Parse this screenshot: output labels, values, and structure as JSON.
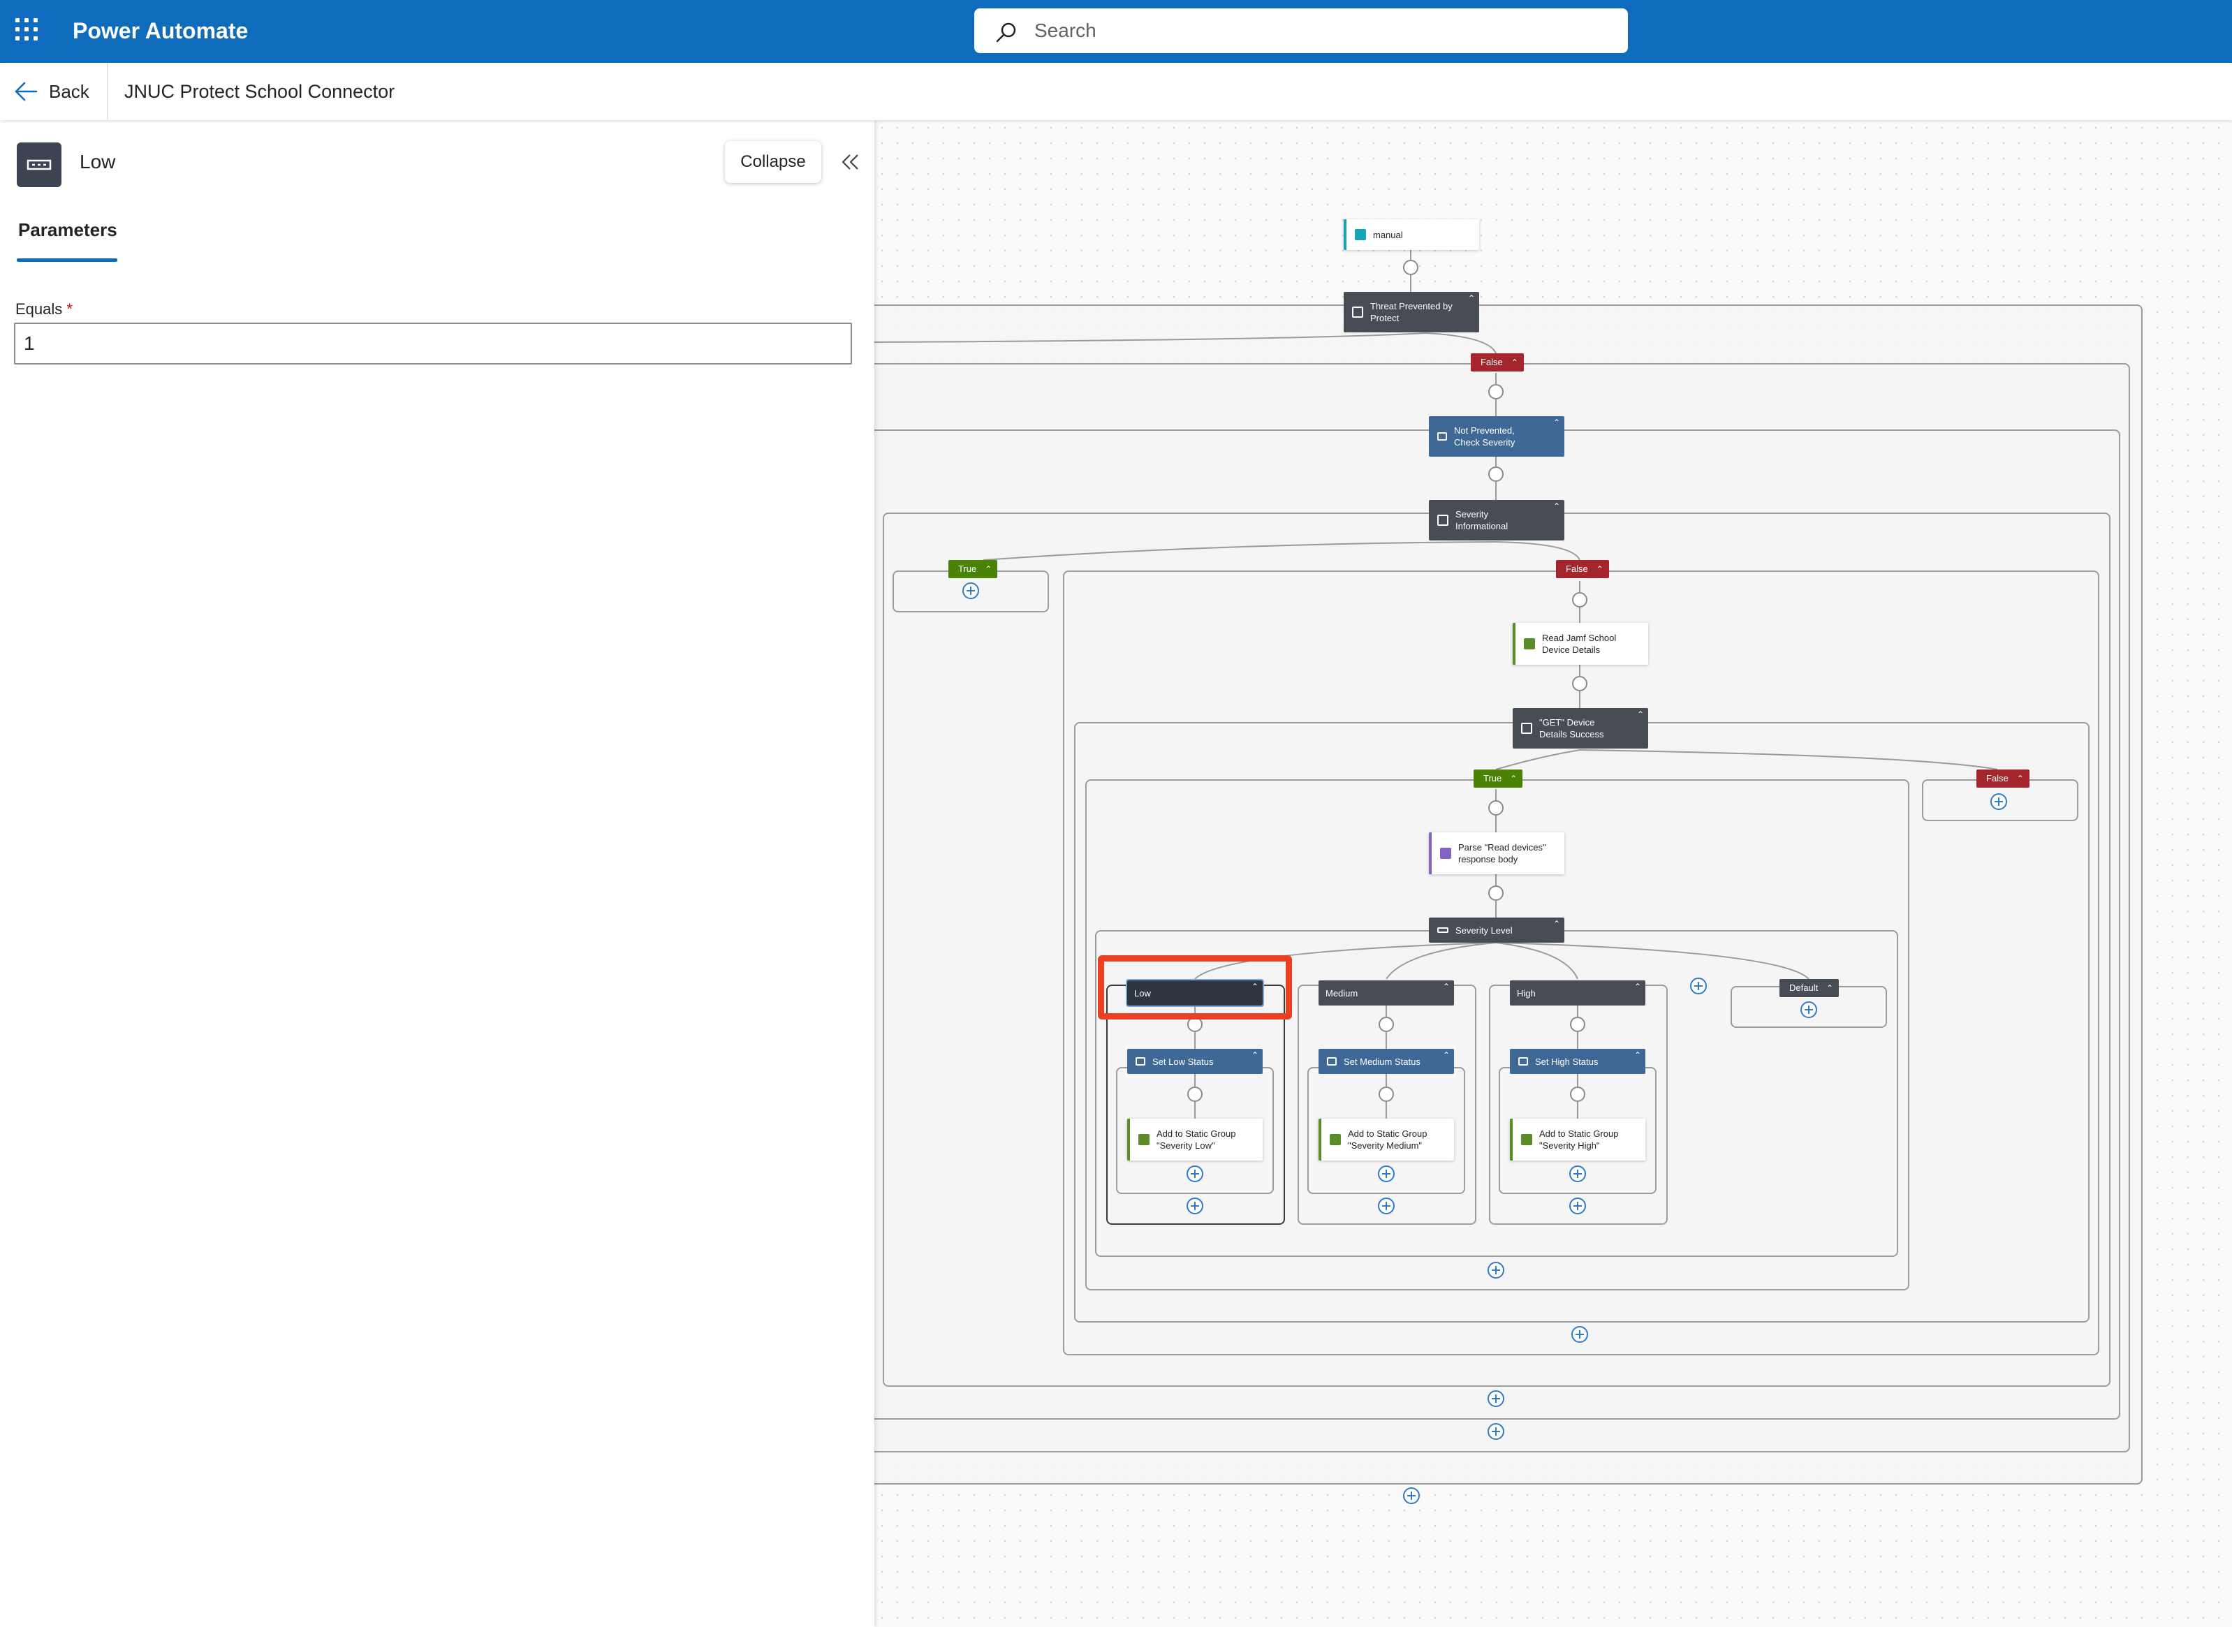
{
  "topbar": {
    "app_name": "Power Automate",
    "search_placeholder": "Search",
    "color": "#0f6cbd"
  },
  "subbar": {
    "back_label": "Back",
    "flow_title": "JNUC Protect School Connector"
  },
  "panel": {
    "title": "Low",
    "collapse_label": "Collapse",
    "tab_label": "Parameters",
    "field_label": "Equals",
    "required_marker": "*",
    "field_value": "1"
  },
  "canvas": {
    "nodes": {
      "manual": "manual",
      "threat": "Threat Prevented by Protect",
      "not_prevented": "Not Prevented, Check Severity",
      "severity_info": "Severity Informational",
      "read_jamf": "Read Jamf School Device Details",
      "get_device": "\"GET\" Device Details Success",
      "parse": "Parse \"Read devices\" response body",
      "severity_level": "Severity Level",
      "case_low": "Low",
      "case_medium": "Medium",
      "case_high": "High",
      "case_default": "Default",
      "set_low": "Set Low Status",
      "set_medium": "Set Medium Status",
      "set_high": "Set High Status",
      "add_low": "Add to Static Group \"Severity Low\"",
      "add_medium": "Add to Static Group \"Severity Medium\"",
      "add_high": "Add to Static Group \"Severity High\""
    },
    "branches": {
      "false": "False",
      "true": "True"
    },
    "colors": {
      "condition": "#474c55",
      "variable": "#3e6896",
      "true_branch": "#498205",
      "false_branch": "#a4262c",
      "highlight": "#ea3f22"
    }
  }
}
